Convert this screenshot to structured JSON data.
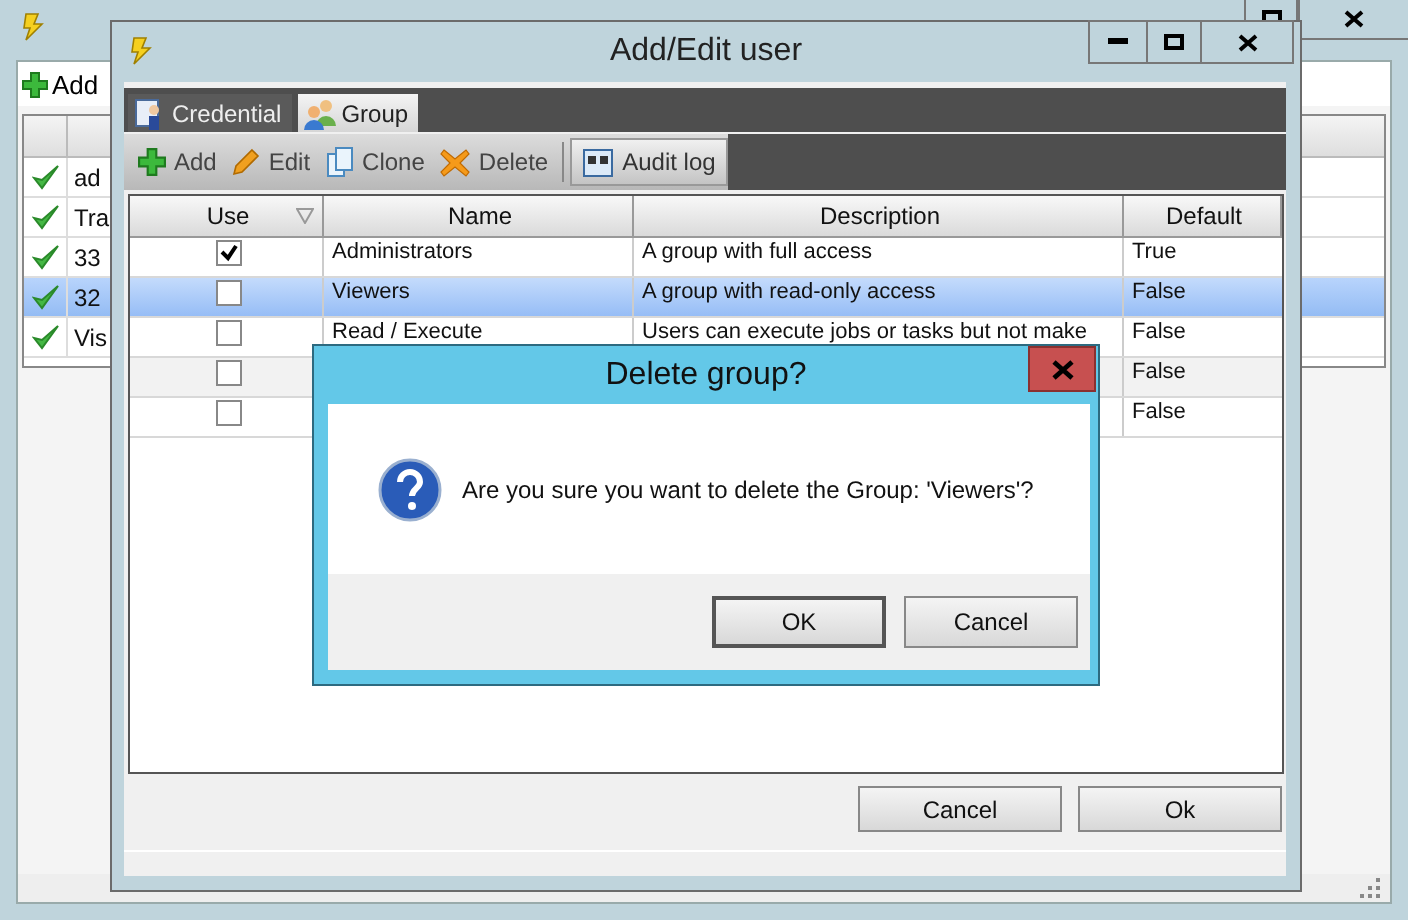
{
  "background_window": {
    "toolbar": {
      "add": "Add"
    },
    "rows": [
      {
        "name": "ad",
        "selected": false
      },
      {
        "name": "Tra",
        "selected": false
      },
      {
        "name": "33",
        "selected": false
      },
      {
        "name": "32",
        "selected": true
      },
      {
        "name": "Vis",
        "selected": false
      }
    ]
  },
  "dialog": {
    "title": "Add/Edit user",
    "tabs": [
      {
        "label": "Credential",
        "kind": "credential",
        "selected": false
      },
      {
        "label": "Group",
        "kind": "group",
        "selected": true
      }
    ],
    "toolbar": [
      {
        "label": "Add",
        "kind": "add"
      },
      {
        "label": "Edit",
        "kind": "edit"
      },
      {
        "label": "Clone",
        "kind": "clone"
      },
      {
        "label": "Delete",
        "kind": "delete"
      },
      {
        "label": "Audit log",
        "kind": "audit"
      }
    ],
    "table": {
      "columns": [
        "Use",
        "Name",
        "Description",
        "Default"
      ],
      "rows": [
        {
          "use": true,
          "name": "Administrators",
          "description": "A group with full access",
          "default": "True",
          "selected": false
        },
        {
          "use": false,
          "name": "Viewers",
          "description": "A group with read-only access",
          "default": "False",
          "selected": true
        },
        {
          "use": false,
          "name": "Read / Execute",
          "description": "Users can execute jobs or tasks but not make",
          "default": "False",
          "selected": false
        },
        {
          "use": false,
          "default": "False",
          "selected": false
        },
        {
          "use": false,
          "default": "False",
          "selected": false
        }
      ]
    },
    "buttons": [
      "Cancel",
      "Ok"
    ]
  },
  "confirm": {
    "title": "Delete group?",
    "message": "Are you sure you want to delete the Group: 'Viewers'?",
    "buttons": [
      "OK",
      "Cancel"
    ]
  }
}
